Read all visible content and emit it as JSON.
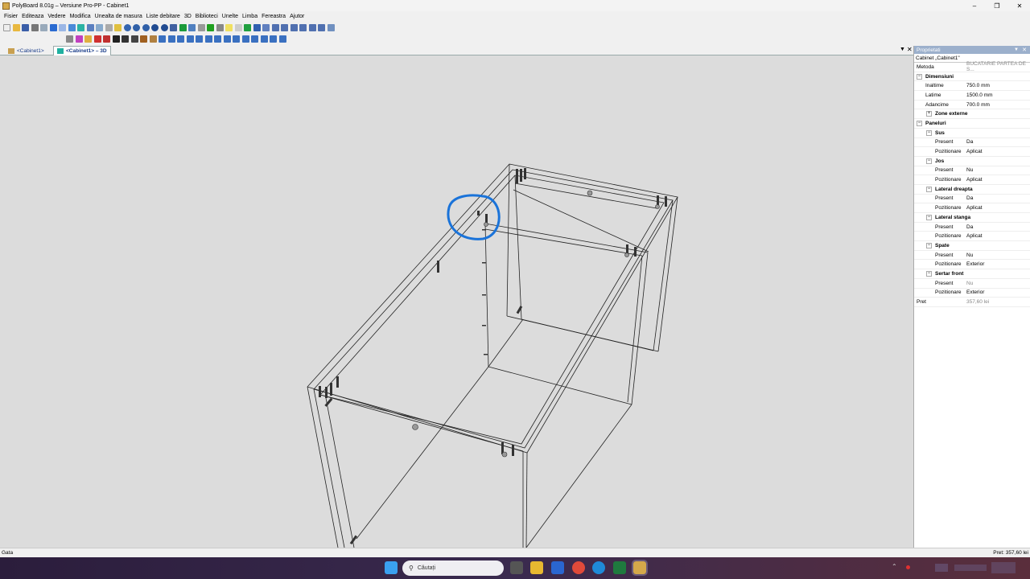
{
  "window": {
    "title": "PolyBoard 8.01g – Versiune Pro-PP - Cabinet1"
  },
  "menu": [
    "Fisier",
    "Editeaza",
    "Vedere",
    "Modifica",
    "Unealta de masura",
    "Liste debitare",
    "3D",
    "Biblioteci",
    "Unelte",
    "Limba",
    "Fereastra",
    "Ajutor"
  ],
  "tabs": [
    {
      "label": "<Cabinet1>"
    },
    {
      "label": "<Cabinet1> – 3D"
    }
  ],
  "properties": {
    "panel_title": "Proprietati",
    "object_name": "Cabinet „Cabinet1\"",
    "metoda": {
      "label": "Metoda",
      "value": "BUCATARIE PARTEA DE S..."
    },
    "dimensiuni": {
      "label": "Dimensiuni",
      "inaltime": {
        "label": "Inaltime",
        "value": "750.0 mm"
      },
      "latime": {
        "label": "Latime",
        "value": "1500.0 mm"
      },
      "adancime": {
        "label": "Adancime",
        "value": "700.0 mm"
      },
      "zone_externe": "Zone externe"
    },
    "paneluri": {
      "label": "Paneluri",
      "sus": {
        "label": "Sus",
        "present_label": "Present",
        "present": "Da",
        "pozitionare_label": "Pozitionare",
        "pozitionare": "Aplicat"
      },
      "jos": {
        "label": "Jos",
        "present_label": "Present",
        "present": "Nu",
        "pozitionare_label": "Pozitionare",
        "pozitionare": "Aplicat"
      },
      "lateral_dreapta": {
        "label": "Lateral dreapta",
        "present_label": "Present",
        "present": "Da",
        "pozitionare_label": "Pozitionare",
        "pozitionare": "Aplicat"
      },
      "lateral_stanga": {
        "label": "Lateral stanga",
        "present_label": "Present",
        "present": "Da",
        "pozitionare_label": "Pozitionare",
        "pozitionare": "Aplicat"
      },
      "spate": {
        "label": "Spate",
        "present_label": "Present",
        "present": "Nu",
        "pozitionare_label": "Pozitionare",
        "pozitionare": "Exterior"
      },
      "sertar_front": {
        "label": "Sertar front",
        "present_label": "Present",
        "present": "Nu",
        "pozitionare_label": "Pozitionare",
        "pozitionare": "Exterior"
      }
    },
    "pret": {
      "label": "Pret",
      "value": "357,60 lei"
    }
  },
  "status": {
    "left": "Gata",
    "right": "Pret: 357,60 lei"
  },
  "taskbar": {
    "search_placeholder": "Căutați"
  },
  "colors": {
    "annotation_circle": "#1a73d9",
    "viewport_bg": "#dcdcdc",
    "taskbar": "#2b1d3c"
  }
}
